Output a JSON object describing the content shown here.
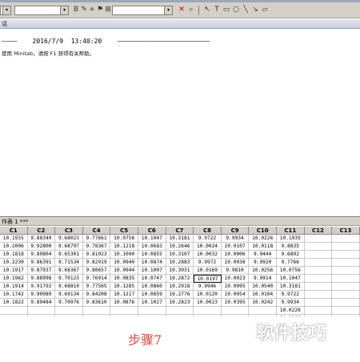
{
  "toolbar": {
    "icons": [
      "bold-x-icon",
      "search-icon",
      "pointer-icon",
      "text-icon",
      "rectangle-icon",
      "ellipse-icon",
      "line-icon",
      "arrow-icon",
      "polygon-icon"
    ]
  },
  "session": {
    "window_title": "话",
    "timestamp_line": "————    2016/7/9  13:40:20    ————————————————————————",
    "help_line": "使用 Minitab，请按 F1 获得有关帮助。"
  },
  "worksheet": {
    "window_title": "作表 1 ***",
    "columns": [
      "C1",
      "C2",
      "C3",
      "C4",
      "C5",
      "C6",
      "C7",
      "C8",
      "C9",
      "C10",
      "C11",
      "C12",
      "C13"
    ],
    "rows": [
      [
        "10.1935",
        "9.88349",
        "9.68023",
        "9.77661",
        "10.0756",
        "10.1047",
        "10.3181",
        "9.9722",
        "9.9934",
        "10.0226",
        "10.1935",
        "",
        ""
      ],
      [
        "10.2006",
        "9.92800",
        "9.68797",
        "9.78367",
        "10.1218",
        "10.0683",
        "10.2646",
        "10.0024",
        "10.0107",
        "10.0118",
        "9.8835",
        "",
        ""
      ],
      [
        "10.1818",
        "9.89804",
        "9.65301",
        "9.81023",
        "10.1090",
        "10.0855",
        "10.3107",
        "10.0032",
        "10.0006",
        "9.9444",
        "9.6892",
        "",
        ""
      ],
      [
        "10.2230",
        "9.86391",
        "9.71534",
        "9.82919",
        "10.0940",
        "10.0874",
        "10.2883",
        "9.9972",
        "10.0038",
        "9.9920",
        "9.7766",
        "",
        ""
      ],
      [
        "10.1917",
        "9.87937",
        "9.68367",
        "9.80657",
        "10.0944",
        "10.1007",
        "10.3031",
        "10.0169",
        "9.9810",
        "10.0256",
        "10.0756",
        "",
        ""
      ],
      [
        "10.1962",
        "9.88998",
        "9.70123",
        "9.76914",
        "10.0835",
        "10.0747",
        "10.2872",
        "10.0197",
        "10.0023",
        "9.9914",
        "10.1047",
        "",
        ""
      ],
      [
        "10.1914",
        "9.91792",
        "9.68810",
        "9.77565",
        "10.1285",
        "10.0860",
        "10.2918",
        "9.9946",
        "10.0095",
        "10.0540",
        "10.3181",
        "",
        ""
      ],
      [
        "10.1742",
        "9.90989",
        "9.69134",
        "9.84208",
        "10.1217",
        "10.0859",
        "10.2776",
        "10.0120",
        "10.0054",
        "10.0104",
        "9.9722",
        "",
        ""
      ],
      [
        "10.1822",
        "9.89484",
        "9.70976",
        "9.83610",
        "10.0876",
        "10.1027",
        "10.2823",
        "10.0023",
        "10.0395",
        "10.0242",
        "9.9934",
        "",
        ""
      ],
      [
        "",
        "",
        "",
        "",
        "",
        "",
        "",
        "",
        "",
        "",
        "10.0226",
        "",
        ""
      ],
      [
        "",
        "",
        "",
        "",
        "",
        "",
        "",
        "",
        "",
        "",
        "10.2006",
        "",
        ""
      ]
    ],
    "active_cell": {
      "row": 5,
      "col": 7
    }
  },
  "watermark": {
    "step": "步骤7",
    "brand": "软件技巧"
  }
}
